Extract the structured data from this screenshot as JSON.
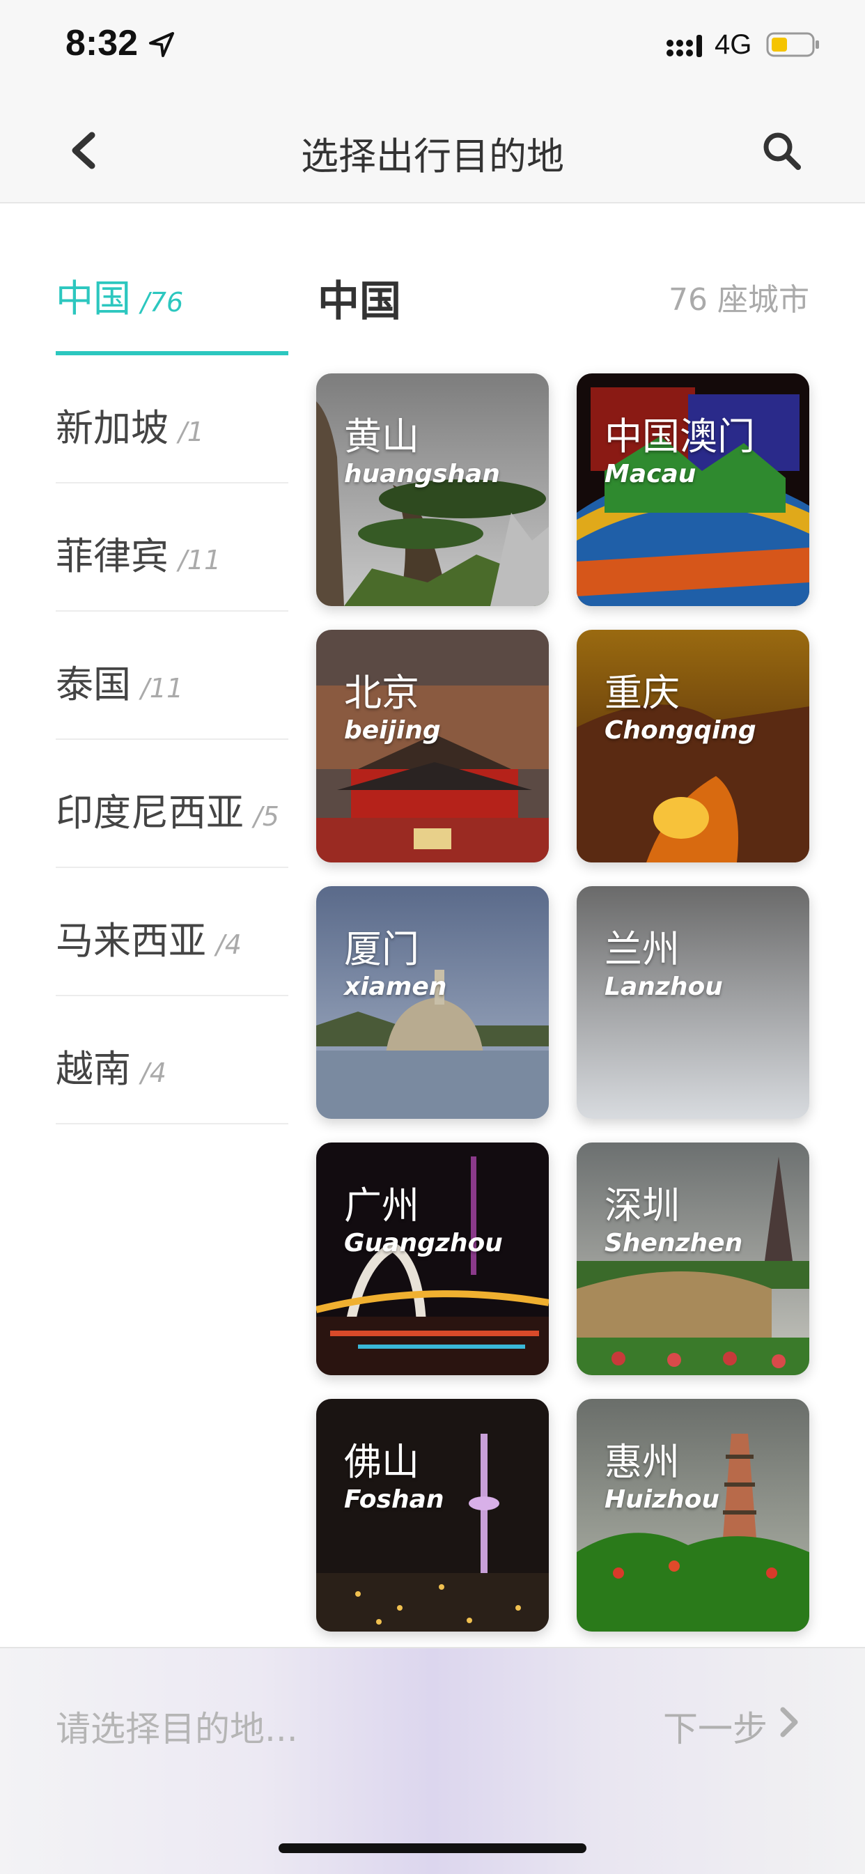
{
  "status": {
    "time": "8:32",
    "network": "4G",
    "battery_color": "#f5c400"
  },
  "nav": {
    "title": "选择出行目的地",
    "back_icon": "chevron-left-icon",
    "search_icon": "search-icon"
  },
  "sidebar": {
    "items": [
      {
        "label": "中国",
        "count": "/76",
        "active": true
      },
      {
        "label": "新加坡",
        "count": "/1"
      },
      {
        "label": "菲律宾",
        "count": "/11"
      },
      {
        "label": "泰国",
        "count": "/11"
      },
      {
        "label": "印度尼西亚",
        "count": "/5"
      },
      {
        "label": "马来西亚",
        "count": "/4"
      },
      {
        "label": "越南",
        "count": "/4"
      }
    ]
  },
  "content": {
    "title": "中国",
    "count": "76 座城市"
  },
  "cities": [
    {
      "cn": "黄山",
      "en": "huangshan"
    },
    {
      "cn": "中国澳门",
      "en": "Macau"
    },
    {
      "cn": "北京",
      "en": "beijing"
    },
    {
      "cn": "重庆",
      "en": "Chongqing"
    },
    {
      "cn": "厦门",
      "en": "xiamen"
    },
    {
      "cn": "兰州",
      "en": "Lanzhou"
    },
    {
      "cn": "广州",
      "en": "Guangzhou"
    },
    {
      "cn": "深圳",
      "en": "Shenzhen"
    },
    {
      "cn": "佛山",
      "en": "Foshan"
    },
    {
      "cn": "惠州",
      "en": "Huizhou"
    }
  ],
  "bottom": {
    "placeholder": "请选择目的地...",
    "next_label": "下一步"
  },
  "colors": {
    "accent": "#2cc7bf"
  }
}
